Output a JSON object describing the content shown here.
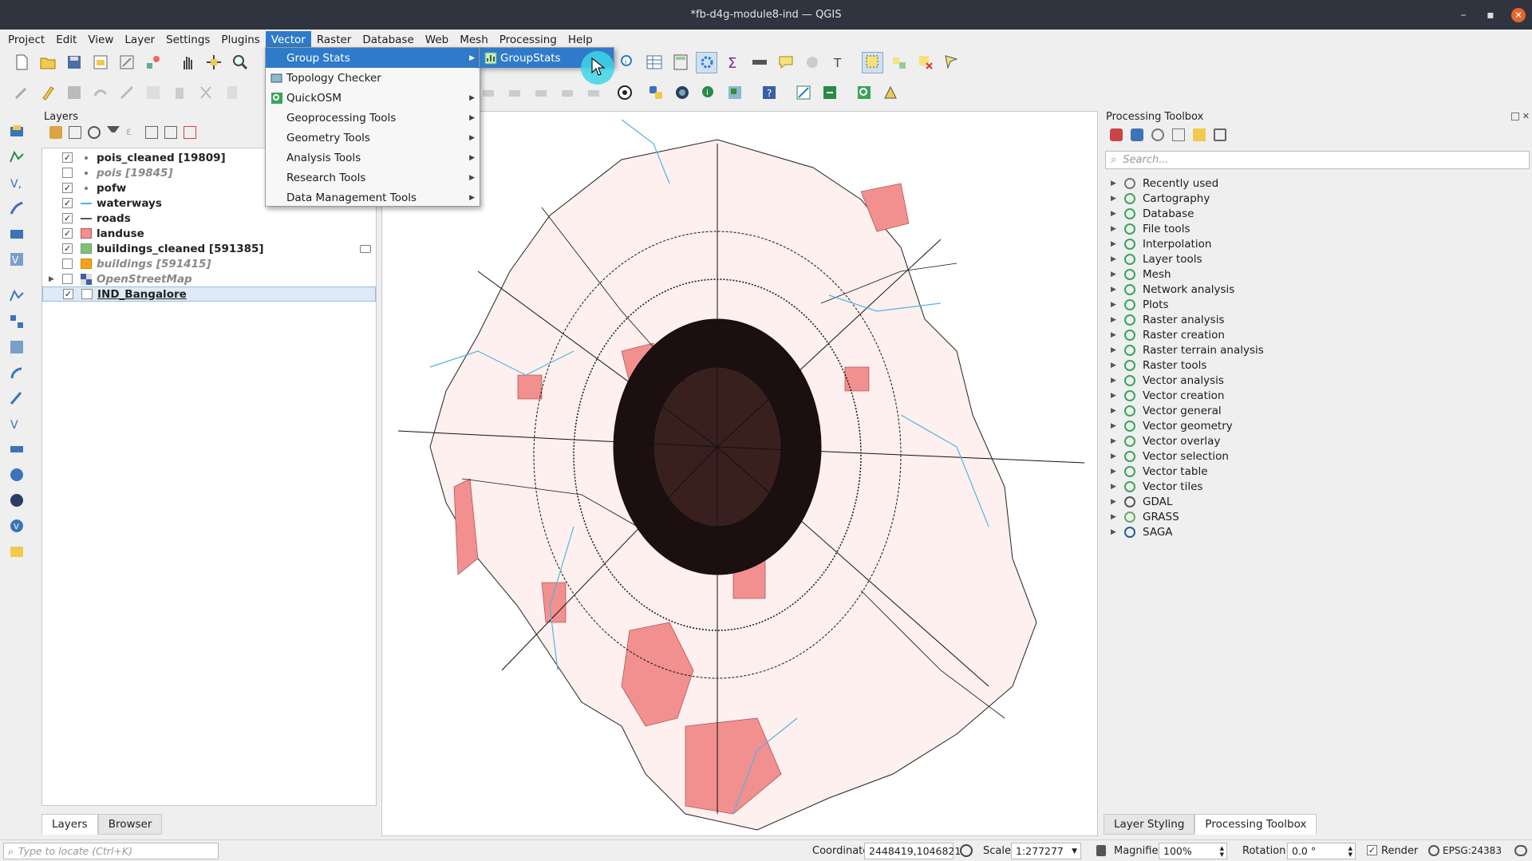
{
  "window": {
    "title": "*fb-d4g-module8-ind — QGIS"
  },
  "menubar": {
    "items": [
      "Project",
      "Edit",
      "View",
      "Layer",
      "Settings",
      "Plugins",
      "Vector",
      "Raster",
      "Database",
      "Web",
      "Mesh",
      "Processing",
      "Help"
    ],
    "active": "Vector"
  },
  "vector_menu": {
    "items": [
      {
        "label": "Group Stats",
        "submenu": true,
        "highlighted": true
      },
      {
        "label": "Topology Checker",
        "submenu": false
      },
      {
        "label": "QuickOSM",
        "submenu": true
      },
      {
        "label": "Geoprocessing Tools",
        "submenu": true
      },
      {
        "label": "Geometry Tools",
        "submenu": true
      },
      {
        "label": "Analysis Tools",
        "submenu": true
      },
      {
        "label": "Research Tools",
        "submenu": true
      },
      {
        "label": "Data Management Tools",
        "submenu": true
      }
    ],
    "submenu_item": "GroupStats"
  },
  "layers_panel": {
    "title": "Layers",
    "layers": [
      {
        "name": "pois_cleaned [19809]",
        "checked": true,
        "symbol": "point-dot"
      },
      {
        "name": "pois [19845]",
        "checked": false,
        "symbol": "point-dot"
      },
      {
        "name": "pofw",
        "checked": true,
        "symbol": "point-dot"
      },
      {
        "name": "waterways",
        "checked": true,
        "symbol": "line-blue"
      },
      {
        "name": "roads",
        "checked": true,
        "symbol": "line-gray"
      },
      {
        "name": "landuse",
        "checked": true,
        "symbol": "fill-salmon"
      },
      {
        "name": "buildings_cleaned [591385]",
        "checked": true,
        "symbol": "fill-green"
      },
      {
        "name": "buildings [591415]",
        "checked": false,
        "symbol": "fill-orange"
      },
      {
        "name": "OpenStreetMap",
        "checked": false,
        "symbol": "raster-tiles"
      },
      {
        "name": "IND_Bangalore",
        "checked": true,
        "symbol": "fill-white"
      }
    ],
    "tabs": [
      "Layers",
      "Browser"
    ]
  },
  "processing_toolbox": {
    "title": "Processing Toolbox",
    "search_placeholder": "Search...",
    "groups": [
      "Recently used",
      "Cartography",
      "Database",
      "File tools",
      "Interpolation",
      "Layer tools",
      "Mesh",
      "Network analysis",
      "Plots",
      "Raster analysis",
      "Raster creation",
      "Raster terrain analysis",
      "Raster tools",
      "Vector analysis",
      "Vector creation",
      "Vector general",
      "Vector geometry",
      "Vector overlay",
      "Vector selection",
      "Vector table",
      "Vector tiles",
      "GDAL",
      "GRASS",
      "SAGA"
    ],
    "tabs": [
      "Layer Styling",
      "Processing Toolbox"
    ]
  },
  "statusbar": {
    "locator_placeholder": "Type to locate (Ctrl+K)",
    "coordinate_label": "Coordinate",
    "coordinate_value": "2448419,1046821",
    "scale_label": "Scale",
    "scale_value": "1:277277",
    "magnifier_label": "Magnifier",
    "magnifier_value": "100%",
    "rotation_label": "Rotation",
    "rotation_value": "0.0 °",
    "render_label": "Render",
    "render_checked": true,
    "crs": "EPSG:24383"
  },
  "colors": {
    "accent": "#2f7bc9",
    "landuse": "#f28f8f",
    "boundary_fill": "#fdf0ee",
    "roads": "#111111",
    "waterways": "#4fb6e0"
  }
}
